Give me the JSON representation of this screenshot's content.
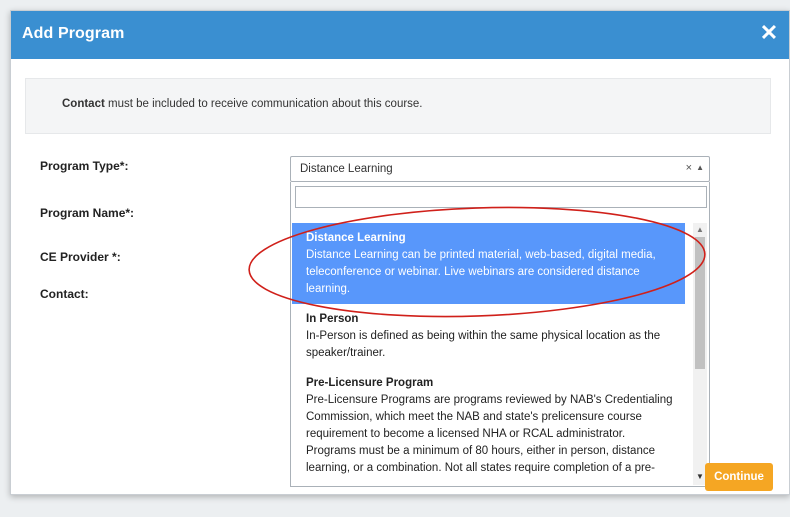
{
  "modal": {
    "title": "Add Program",
    "close_label": "✕",
    "notice": {
      "bold": "Contact",
      "rest": " must be included to receive communication about this course."
    },
    "labels": {
      "program_type": "Program Type*:",
      "program_name": "Program Name*:",
      "ce_provider": "CE Provider *:",
      "contact": "Contact:"
    },
    "select": {
      "value": "Distance Learning",
      "clear": "×",
      "search_value": ""
    },
    "options": [
      {
        "title": "Distance Learning",
        "description": "Distance Learning can be printed material, web-based, digital media, teleconference or webinar. Live webinars are considered distance learning.",
        "selected": true
      },
      {
        "title": "In Person",
        "description": "In-Person is defined as being within the same physical location as the speaker/trainer.",
        "selected": false
      },
      {
        "title": "Pre-Licensure Program",
        "description": "Pre-Licensure Programs are programs reviewed by NAB's Credentialing Commission, which meet the NAB and state's prelicensure course requirement to become a licensed NHA or RCAL administrator. Programs must be a minimum of 80 hours, either in person, distance learning, or a combination. Not all states require completion of a pre-",
        "selected": false
      }
    ],
    "continue_label": "Continue"
  },
  "colors": {
    "header": "#3a8fd1",
    "selected_option": "#5897fb",
    "continue_button": "#f5a623",
    "annotation": "#d0201a"
  }
}
